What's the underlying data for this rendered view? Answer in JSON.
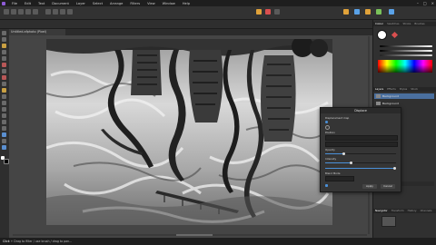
{
  "menu": {
    "items": [
      "File",
      "Edit",
      "Text",
      "Document",
      "Layer",
      "Select",
      "Arrange",
      "Filters",
      "View",
      "Window",
      "Help"
    ]
  },
  "document": {
    "tab_title": "Untitled.afphoto (Pixel)"
  },
  "panels": {
    "top_tabs": [
      "Colour",
      "Swatches",
      "Stroke",
      "Brushes"
    ],
    "layers_tabs": [
      "Layers",
      "Effects",
      "Styles",
      "Stock"
    ],
    "nav_tabs": [
      "Navigator",
      "Transform",
      "History",
      "Channels"
    ],
    "layers": [
      "Background",
      "Background"
    ]
  },
  "dialog": {
    "title": "Displace",
    "row_labels": [
      "Displacement map",
      "Position",
      "Opacity",
      "Intensity",
      "Blend Mode"
    ],
    "apply_label": "Apply",
    "cancel_label": "Cancel"
  },
  "status": {
    "bold": "Click",
    "rest": " + Drag to filter / use brush / drag to pan..."
  },
  "colors": {
    "accent": "#4a90d9",
    "logo": "#8e5bd6",
    "highlight": "#d94f4f"
  }
}
